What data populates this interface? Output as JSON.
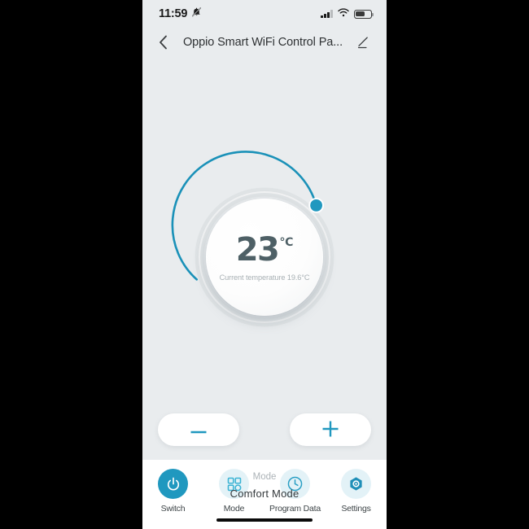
{
  "colors": {
    "accent": "#2098bf",
    "arc": "#1a91b8",
    "track": "#dfe3e5",
    "screen_bg": "#e9ecee",
    "tab_bg": "#ffffff",
    "tab_ico_bg": "#e3f2f7",
    "temp_text": "#4e6066"
  },
  "status_bar": {
    "time": "11:59",
    "mute_icon": "bell-slash-icon",
    "signal_icon": "cellular-signal-icon",
    "signal_bars_filled": 3,
    "signal_bars_total": 4,
    "wifi_icon": "wifi-icon",
    "battery_icon": "battery-icon",
    "battery_level_percent": 55
  },
  "header": {
    "back_icon": "chevron-left-icon",
    "title": "Oppio Smart WiFi Control Pa...",
    "edit_icon": "pencil-edit-icon"
  },
  "dial": {
    "target_temperature": "23",
    "unit": "℃",
    "current_temperature_text": "Current temperature 19.6°C",
    "arc_start_deg": 160,
    "arc_end_deg": 45,
    "knob_icon": "dial-knob-handle"
  },
  "controls": {
    "decrease_label": "−",
    "decrease_icon": "minus-icon",
    "increase_label": "+",
    "increase_icon": "plus-icon"
  },
  "mode": {
    "label": "Mode",
    "value": "Comfort  Mode"
  },
  "tabbar": {
    "items": [
      {
        "label": "Switch",
        "icon": "power-icon",
        "active": true
      },
      {
        "label": "Mode",
        "icon": "grid-mode-icon",
        "active": false
      },
      {
        "label": "Program Data",
        "icon": "clock-icon",
        "active": false
      },
      {
        "label": "Settings",
        "icon": "hexagon-gear-icon",
        "active": false
      }
    ]
  },
  "home_indicator": "home-indicator-bar"
}
